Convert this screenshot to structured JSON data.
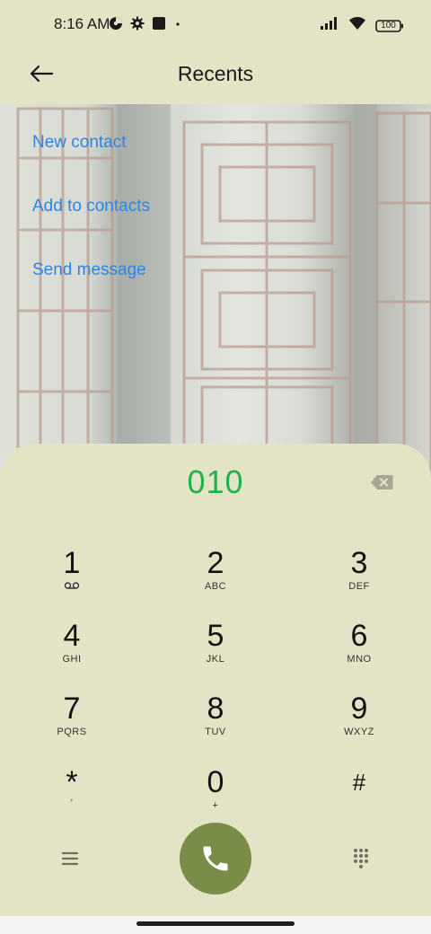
{
  "status_bar": {
    "time": "8:16 AM",
    "battery": "100",
    "icons": [
      "data-saver-icon",
      "settings-icon",
      "square-icon",
      "dot-icon",
      "signal-icon",
      "wifi-icon",
      "battery-icon"
    ]
  },
  "header": {
    "title": "Recents",
    "back_icon": "back-arrow-icon"
  },
  "actions": [
    {
      "label": "New contact"
    },
    {
      "label": "Add to contacts"
    },
    {
      "label": "Send message"
    }
  ],
  "dialer": {
    "number": "010",
    "keys": [
      {
        "digit": "1",
        "letters": ""
      },
      {
        "digit": "2",
        "letters": "ABC"
      },
      {
        "digit": "3",
        "letters": "DEF"
      },
      {
        "digit": "4",
        "letters": "GHI"
      },
      {
        "digit": "5",
        "letters": "JKL"
      },
      {
        "digit": "6",
        "letters": "MNO"
      },
      {
        "digit": "7",
        "letters": "PQRS"
      },
      {
        "digit": "8",
        "letters": "TUV"
      },
      {
        "digit": "9",
        "letters": "WXYZ"
      },
      {
        "digit": "*",
        "letters": ","
      },
      {
        "digit": "0",
        "letters": "+"
      },
      {
        "digit": "#",
        "letters": ""
      }
    ]
  },
  "colors": {
    "background": "#e3e3c6",
    "link": "#2b86e6",
    "number": "#22b24c",
    "call_button": "#7a8d48"
  }
}
